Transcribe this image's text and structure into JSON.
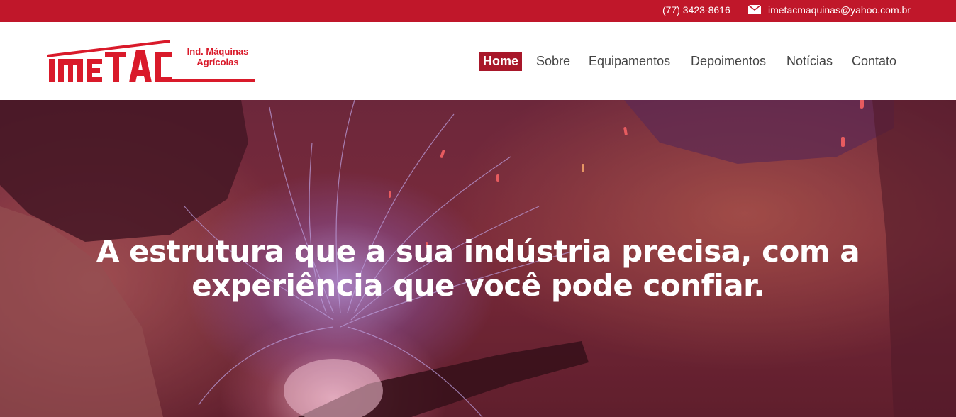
{
  "topbar": {
    "phone": "(77) 3423-8616",
    "email": "imetacmaquinas@yahoo.com.br",
    "mail_icon": "envelope-icon",
    "background": "#c0172a"
  },
  "logo": {
    "wordmark": "IMETAC",
    "line1": "Ind. Máquinas",
    "line2": "Agrícolas",
    "color": "#d91a2a"
  },
  "nav": {
    "items": [
      {
        "label": "Home",
        "active": true
      },
      {
        "label": "Sobre",
        "active": false
      },
      {
        "label": "Equipamentos",
        "active": false
      },
      {
        "label": "Depoimentos",
        "active": false
      },
      {
        "label": "Notícias",
        "active": false
      },
      {
        "label": "Contato",
        "active": false
      }
    ],
    "active_color": "#a8172a"
  },
  "hero": {
    "headline": "A estrutura que a sua indústria precisa, com a experiência que você pode confiar."
  }
}
